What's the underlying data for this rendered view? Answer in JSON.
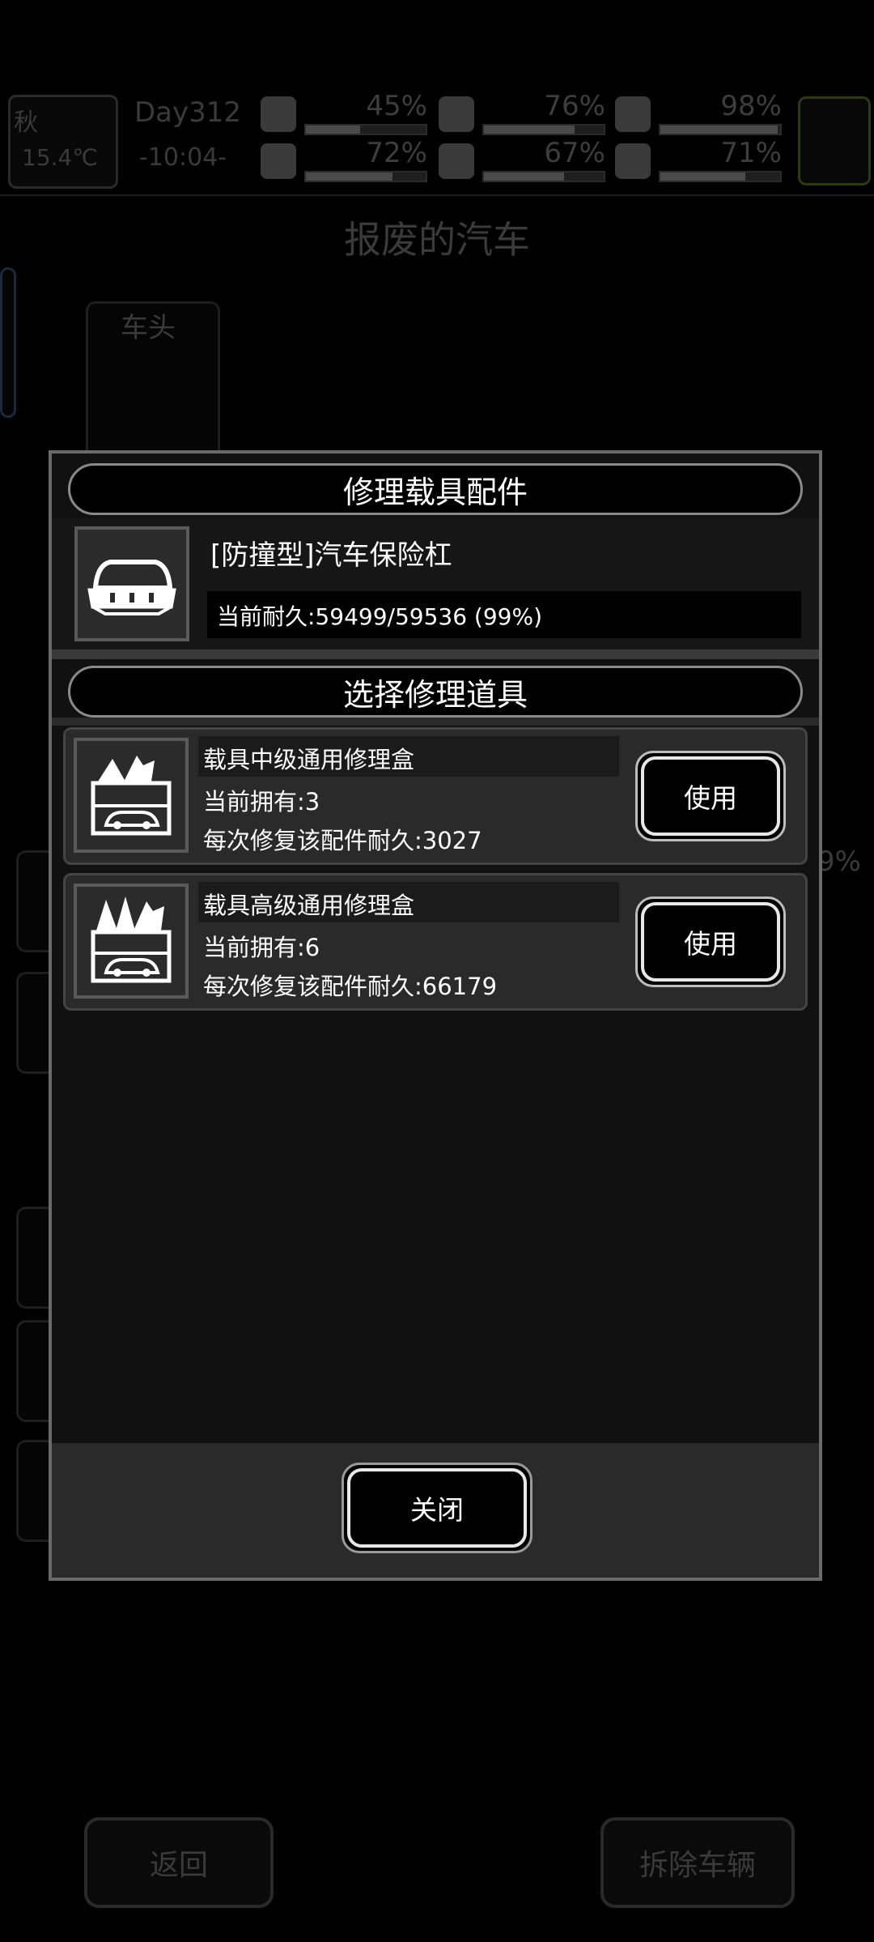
{
  "background": {
    "season": "秋",
    "temperature": "15.4℃",
    "day": "Day312",
    "time": "-10:04-",
    "stats": [
      {
        "icon": "medkit-icon",
        "value": "45%",
        "fill": 0.45
      },
      {
        "icon": "stomach-icon",
        "value": "76%",
        "fill": 0.76
      },
      {
        "icon": "bladder-icon",
        "value": "98%",
        "fill": 0.98
      },
      {
        "icon": "boot-icon",
        "value": "72%",
        "fill": 0.72
      },
      {
        "icon": "water-drop-icon",
        "value": "67%",
        "fill": 0.67
      },
      {
        "icon": "heart-icon",
        "value": "71%",
        "fill": 0.71
      }
    ],
    "page_title": "报废的汽车",
    "part_tab_label": "车头",
    "back_button": "返回",
    "dismantle_button": "拆除车辆",
    "side_value": "9%"
  },
  "modal": {
    "title": "修理载具配件",
    "part": {
      "icon": "car-bumper-icon",
      "name": "[防撞型]汽车保险杠",
      "durability": "当前耐久:59499/59536 (99%)"
    },
    "select_title": "选择修理道具",
    "tools": [
      {
        "icon": "repair-kit-icon",
        "name": "载具中级通用修理盒",
        "owned": "当前拥有:3",
        "repair": "每次修复该配件耐久:3027",
        "button": "使用"
      },
      {
        "icon": "repair-kit-icon",
        "name": "载具高级通用修理盒",
        "owned": "当前拥有:6",
        "repair": "每次修复该配件耐久:66179",
        "button": "使用"
      }
    ],
    "close_button": "关闭"
  }
}
